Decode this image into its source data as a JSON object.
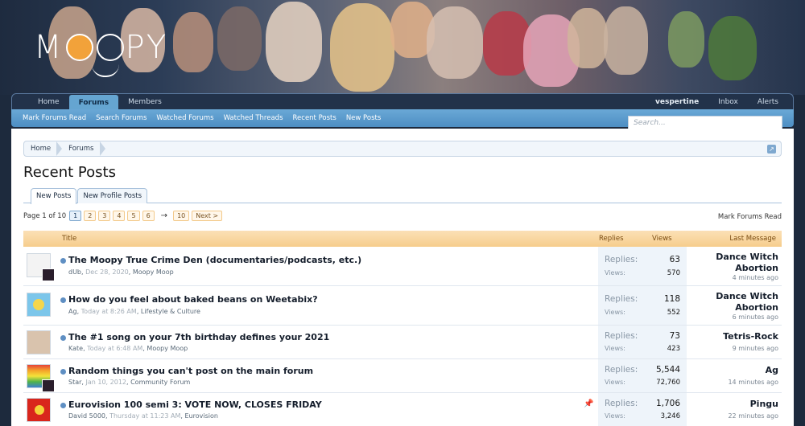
{
  "logo": "MOOPY",
  "nav": {
    "tabs": [
      "Home",
      "Forums",
      "Members"
    ],
    "active": "Forums",
    "user": "vespertine",
    "right": [
      "Inbox",
      "Alerts"
    ],
    "sub": [
      "Mark Forums Read",
      "Search Forums",
      "Watched Forums",
      "Watched Threads",
      "Recent Posts",
      "New Posts"
    ]
  },
  "search": {
    "placeholder": "Search..."
  },
  "breadcrumb": [
    "Home",
    "Forums"
  ],
  "page_title": "Recent Posts",
  "tabs": {
    "new_posts": "New Posts",
    "new_profile_posts": "New Profile Posts"
  },
  "pager": {
    "label": "Page 1 of 10",
    "pages": [
      "1",
      "2",
      "3",
      "4",
      "5",
      "6"
    ],
    "arrow": "→",
    "last": "10",
    "next": "Next >"
  },
  "mark_read": "Mark Forums Read",
  "table_head": {
    "title": "Title",
    "replies": "Replies",
    "views": "Views",
    "last": "Last Message"
  },
  "stats_labels": {
    "replies": "Replies:",
    "views": "Views:"
  },
  "threads": [
    {
      "title": "The Moopy True Crime Den (documentaries/podcasts, etc.)",
      "author": "dUb",
      "date": "Dec 28, 2020",
      "forum": "Moopy Moop",
      "replies": "63",
      "views": "570",
      "last_user": "Dance Witch Abortion",
      "last_time": "4 minutes ago"
    },
    {
      "title": "How do you feel about baked beans on Weetabix?",
      "author": "Ag",
      "date": "Today at 8:26 AM",
      "forum": "Lifestyle & Culture",
      "replies": "118",
      "views": "552",
      "last_user": "Dance Witch Abortion",
      "last_time": "6 minutes ago"
    },
    {
      "title": "The #1 song on your 7th birthday defines your 2021",
      "author": "Kate",
      "date": "Today at 6:48 AM",
      "forum": "Moopy Moop",
      "replies": "73",
      "views": "423",
      "last_user": "Tetris-Rock",
      "last_time": "9 minutes ago"
    },
    {
      "title": "Random things you can't post on the main forum",
      "author": "Star",
      "date": "Jan 10, 2012",
      "forum": "Community Forum",
      "replies": "5,544",
      "views": "72,760",
      "last_user": "Ag",
      "last_time": "14 minutes ago"
    },
    {
      "title": "Eurovision 100 semi 3: VOTE NOW, CLOSES FRIDAY",
      "author": "David 5000",
      "date": "Thursday at 11:23 AM",
      "forum": "Eurovision",
      "replies": "1,706",
      "views": "3,246",
      "last_user": "Pingu",
      "last_time": "22 minutes ago"
    }
  ]
}
